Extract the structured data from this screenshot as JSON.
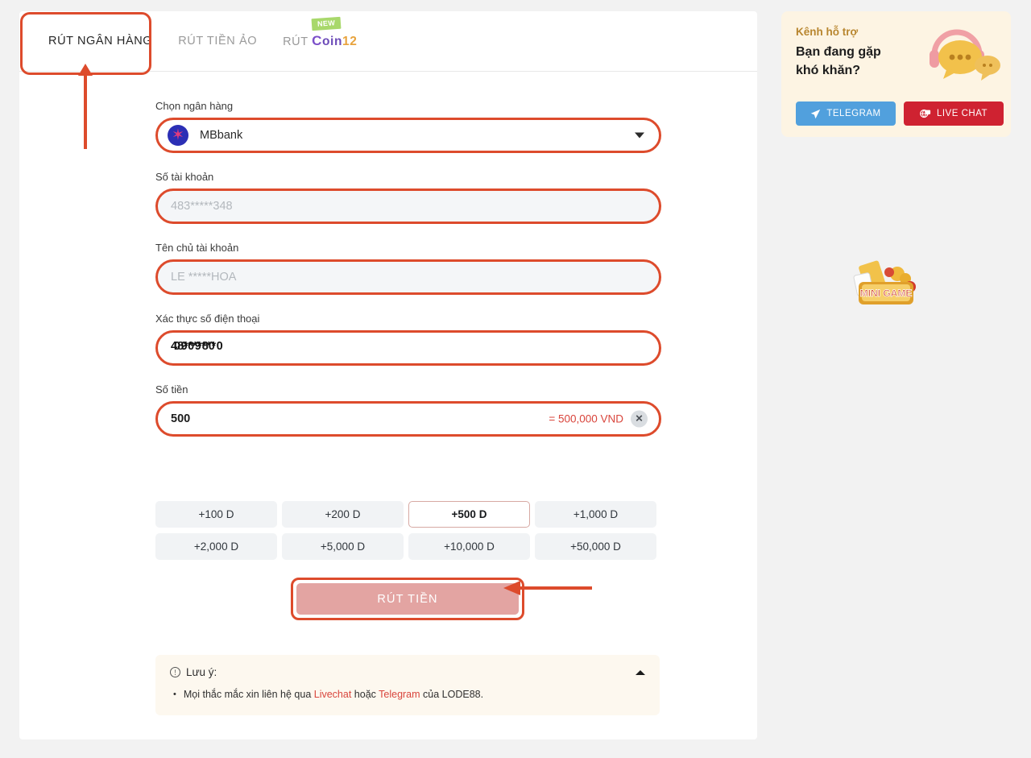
{
  "tabs": [
    {
      "label": "RÚT NGÂN HÀNG",
      "active": true
    },
    {
      "label": "RÚT TIỀN ẢO",
      "active": false
    },
    {
      "label_prefix": "RÚT ",
      "coin_c": "C",
      "coin_oin": "oin",
      "coin_12": "12",
      "badge": "NEW",
      "active": false
    }
  ],
  "form": {
    "bank": {
      "label": "Chọn ngân hàng",
      "selected": "MBbank",
      "icon": "chevron-down-icon"
    },
    "account_number": {
      "label": "Số tài khoản",
      "placeholder": "483*****348",
      "value": ""
    },
    "account_name": {
      "label": "Tên chủ tài khoản",
      "placeholder": "LE *****HOA",
      "value": ""
    },
    "phone": {
      "label": "Xác thực số điện thoại",
      "value_layer1": "48****80",
      "value_layer2": "0909***0"
    },
    "amount": {
      "label": "Số tiền",
      "value": "500",
      "conversion": "= 500,000 VND",
      "clear_icon": "✕"
    }
  },
  "quick_amounts": [
    {
      "label": "+100 D",
      "selected": false
    },
    {
      "label": "+200 D",
      "selected": false
    },
    {
      "label": "+500 D",
      "selected": true
    },
    {
      "label": "+1,000 D",
      "selected": false
    },
    {
      "label": "+2,000 D",
      "selected": false
    },
    {
      "label": "+5,000 D",
      "selected": false
    },
    {
      "label": "+10,000 D",
      "selected": false
    },
    {
      "label": "+50,000 D",
      "selected": false
    }
  ],
  "submit": {
    "label": "RÚT TIỀN"
  },
  "notice": {
    "title": "Lưu ý:",
    "info_icon": "!",
    "collapse_icon": "chevron-up-icon",
    "bullet": "•",
    "item_part1": "Mọi thắc mắc xin liên hệ qua ",
    "item_link1": "Livechat",
    "item_part2": " hoặc ",
    "item_link2": "Telegram",
    "item_part3": " của LODE88."
  },
  "support": {
    "kicker": "Kênh hỗ trợ",
    "title_line1": "Bạn đang gặp",
    "title_line2": "khó khăn?",
    "telegram_label": "TELEGRAM",
    "telegram_icon": "paper-plane-icon",
    "livechat_label": "LIVE CHAT",
    "livechat_icon": "live-chat-icon",
    "art_icon": "headset-chat-bubbles-icon"
  },
  "minigame": {
    "label": "MINI GAME"
  },
  "colors": {
    "accent_red": "#dd4b2c",
    "link_red": "#d9453c",
    "telegram_blue": "#51a0dd",
    "livechat_red": "#cf2231",
    "badge_green": "#a8d86b",
    "support_bg": "#fdf4e3"
  }
}
